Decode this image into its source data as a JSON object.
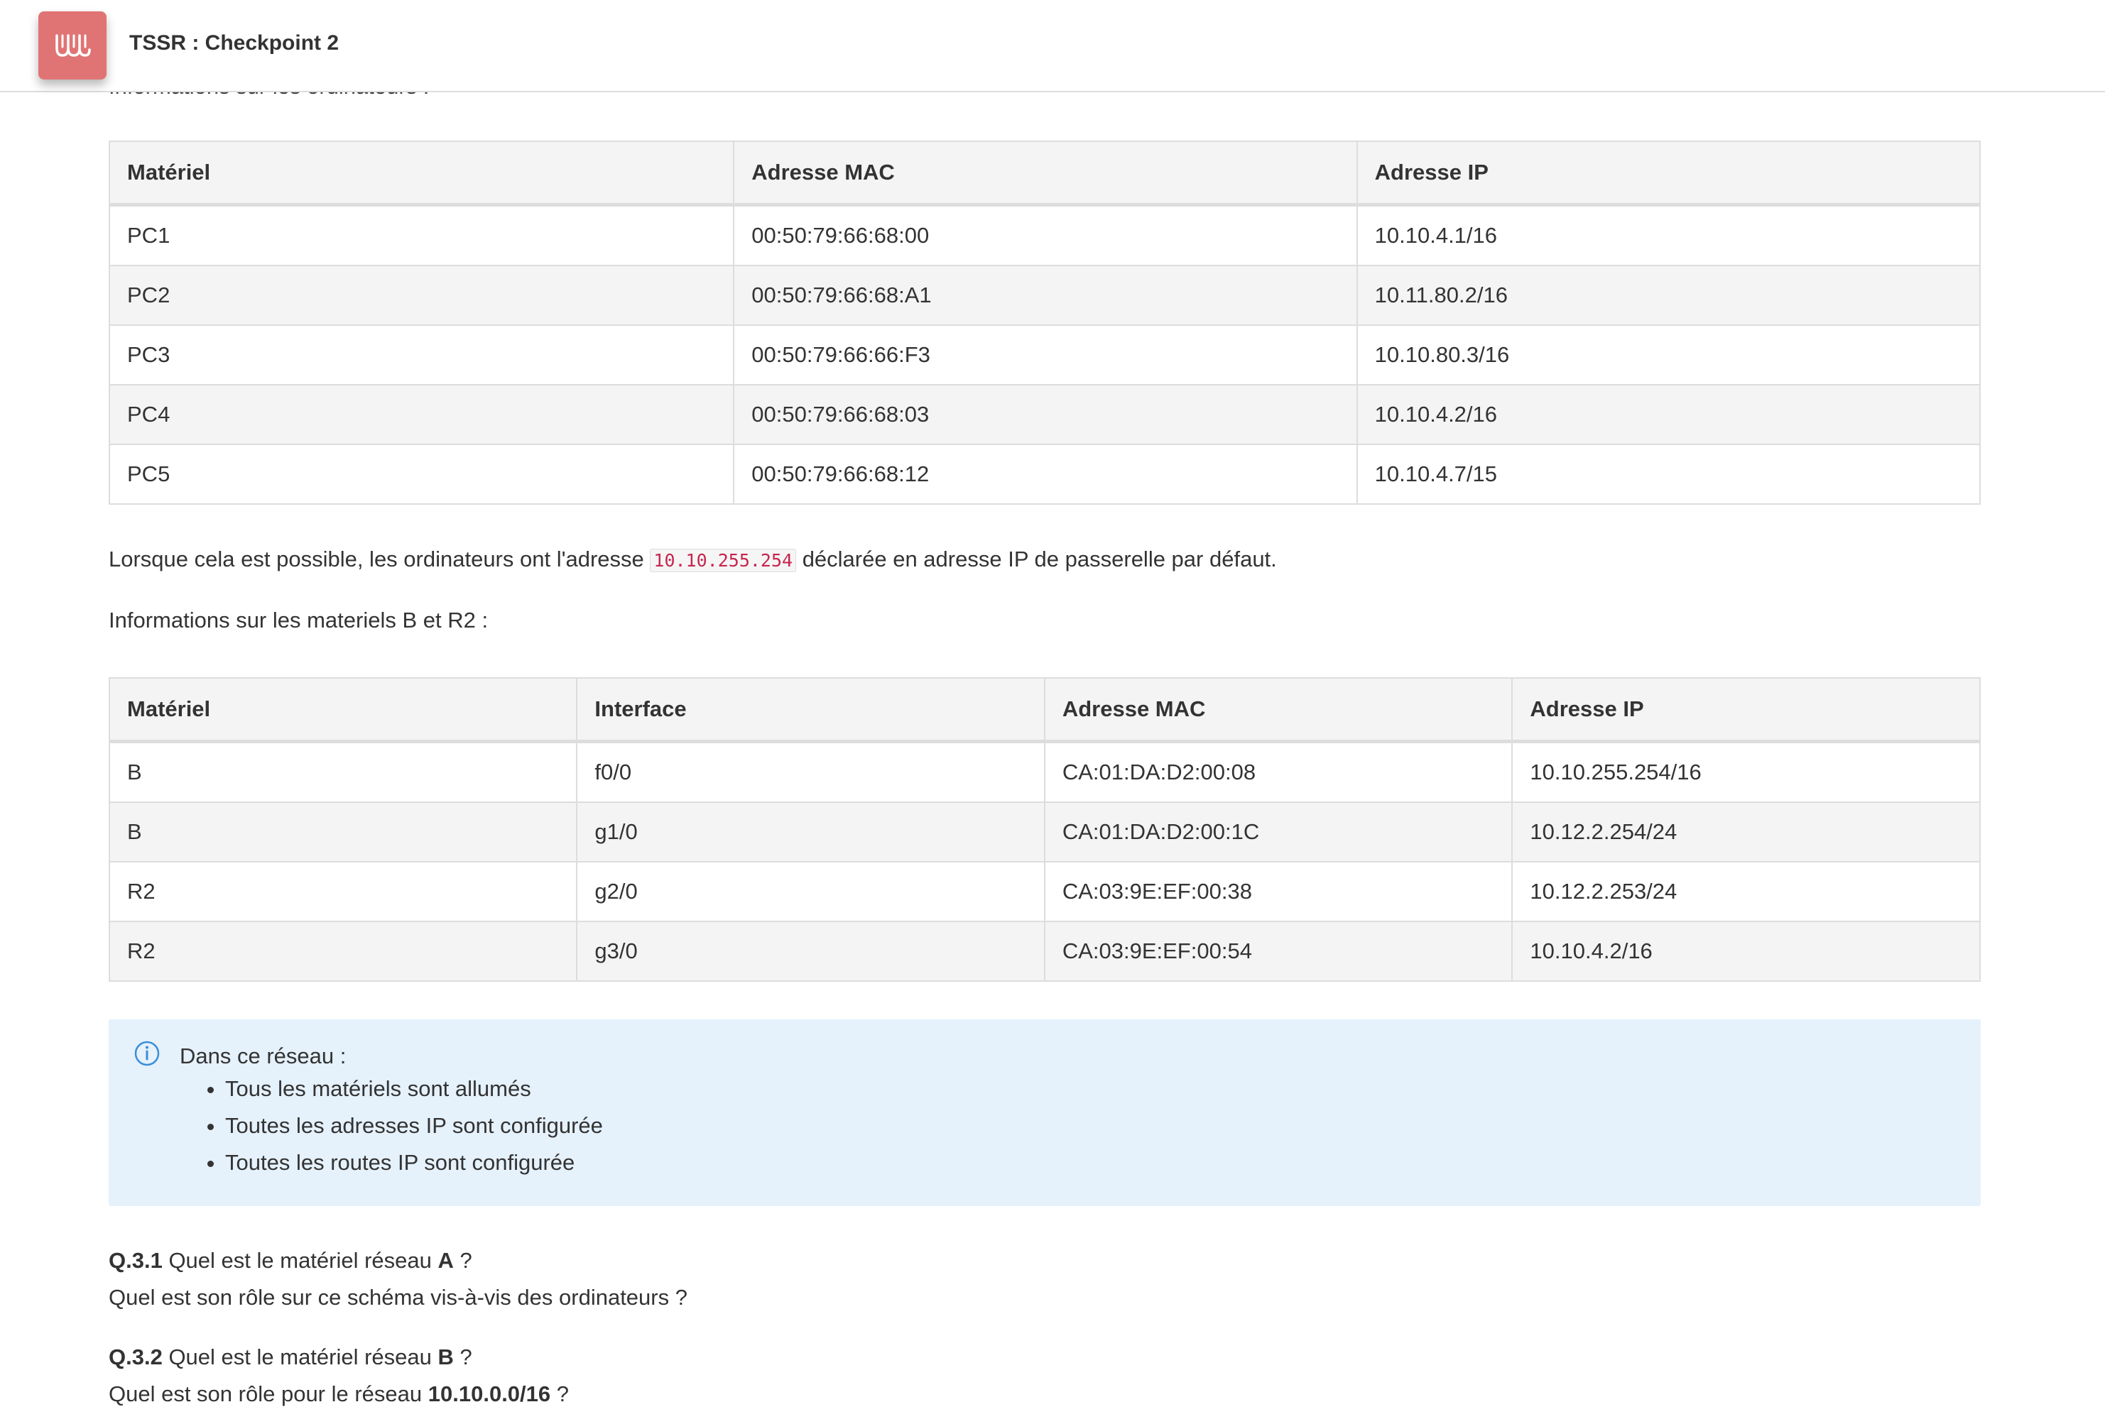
{
  "app": {
    "title": "TSSR : Checkpoint 2",
    "brand_color": "#e07474"
  },
  "clipped_heading": "Informations sur les ordinateurs :",
  "computers_table": {
    "headers": [
      "Matériel",
      "Adresse MAC",
      "Adresse IP"
    ],
    "rows": [
      [
        "PC1",
        "00:50:79:66:68:00",
        "10.10.4.1/16"
      ],
      [
        "PC2",
        "00:50:79:66:68:A1",
        "10.11.80.2/16"
      ],
      [
        "PC3",
        "00:50:79:66:66:F3",
        "10.10.80.3/16"
      ],
      [
        "PC4",
        "00:50:79:66:68:03",
        "10.10.4.2/16"
      ],
      [
        "PC5",
        "00:50:79:66:68:12",
        "10.10.4.7/15"
      ]
    ]
  },
  "gateway_note": {
    "before": "Lorsque cela est possible, les ordinateurs ont l'adresse ",
    "code": "10.10.255.254",
    "after": " déclarée en adresse IP de passerelle par défaut."
  },
  "devices_heading": "Informations sur les materiels B et R2 :",
  "devices_table": {
    "headers": [
      "Matériel",
      "Interface",
      "Adresse MAC",
      "Adresse IP"
    ],
    "rows": [
      [
        "B",
        "f0/0",
        "CA:01:DA:D2:00:08",
        "10.10.255.254/16"
      ],
      [
        "B",
        "g1/0",
        "CA:01:DA:D2:00:1C",
        "10.12.2.254/24"
      ],
      [
        "R2",
        "g2/0",
        "CA:03:9E:EF:00:38",
        "10.12.2.253/24"
      ],
      [
        "R2",
        "g3/0",
        "CA:03:9E:EF:00:54",
        "10.10.4.2/16"
      ]
    ]
  },
  "info_box": {
    "icon": "info-circle-icon",
    "title": "Dans ce réseau :",
    "items": [
      "Tous les matériels sont allumés",
      "Toutes les adresses IP sont configurée",
      "Toutes les routes IP sont configurée"
    ],
    "background": "#e5f1fb",
    "icon_color": "#3a8fd8"
  },
  "questions": [
    {
      "label": "Q.3.1",
      "text_before": " Quel est le matériel réseau ",
      "strong": "A",
      "text_after": " ?",
      "line2_before": "Quel est son rôle sur ce schéma vis-à-vis des ordinateurs ?",
      "line2_strong": "",
      "line2_after": ""
    },
    {
      "label": "Q.3.2",
      "text_before": " Quel est le matériel réseau ",
      "strong": "B",
      "text_after": " ?",
      "line2_before": "Quel est son rôle pour le réseau ",
      "line2_strong": "10.10.0.0/16",
      "line2_after": " ?"
    }
  ]
}
